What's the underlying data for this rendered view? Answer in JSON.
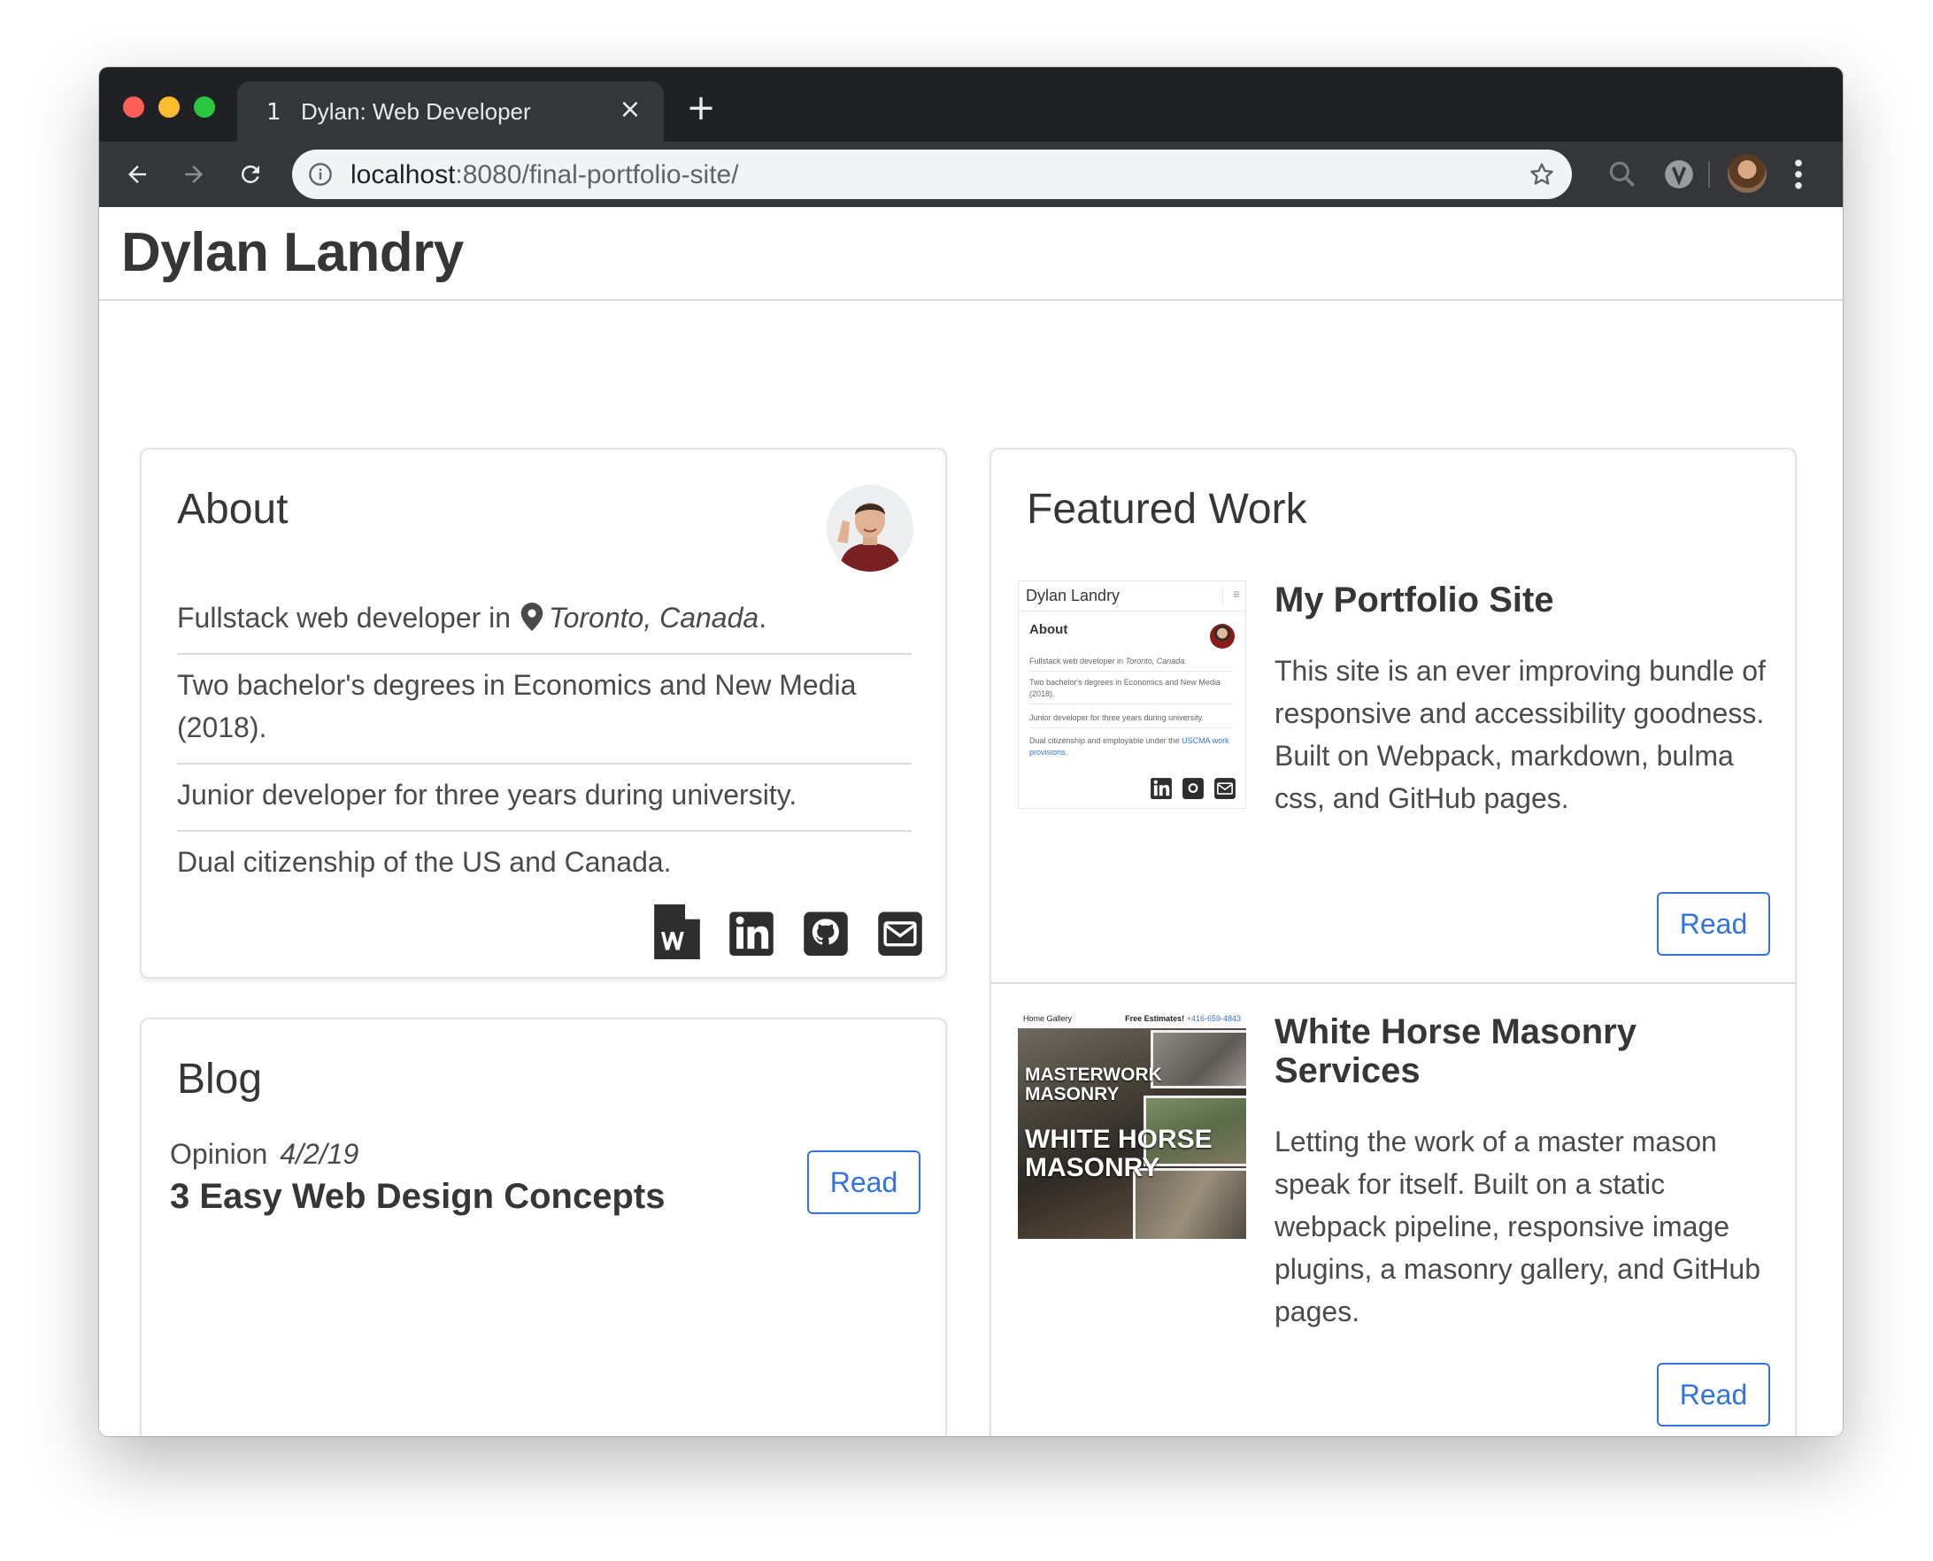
{
  "browser": {
    "tab": {
      "index": "1",
      "title": "Dylan: Web Developer",
      "close": "×"
    },
    "new_tab": "+",
    "url_host": "localhost",
    "url_rest": ":8080/final-portfolio-site/"
  },
  "site": {
    "title": "Dylan Landry"
  },
  "about": {
    "heading": "About",
    "items": {
      "0": {
        "prefix": "Fullstack web developer in",
        "location": "Toronto, Canada",
        "suffix": "."
      },
      "1": {
        "text": "Two bachelor's degrees in Economics and New Media (2018)."
      },
      "2": {
        "text": "Junior developer for three years during university."
      },
      "3": {
        "text": "Dual citizenship of the US and Canada."
      }
    },
    "social": [
      "resume-word-icon",
      "linkedin-icon",
      "github-icon",
      "email-icon"
    ]
  },
  "blog": {
    "heading": "Blog",
    "post": {
      "category": "Opinion",
      "date": "4/2/19",
      "title": "3 Easy Web Design Concepts",
      "read_label": "Read"
    }
  },
  "featured": {
    "heading": "Featured Work",
    "projects": {
      "0": {
        "title": "My Portfolio Site",
        "description": "This site is an ever improving bundle of responsive and accessibility goodness. Built on Webpack, markdown, bulma css, and GitHub pages.",
        "read_label": "Read",
        "thumb": {
          "header": "Dylan Landry",
          "menu": "≡",
          "about": "About",
          "line0_prefix": "Fullstack web developer in",
          "line0_loc": "Toronto, Canada.",
          "line1": "Two bachelor's degrees in Economics and New Media (2018).",
          "line2": "Junior developer for three years during university.",
          "line3_prefix": "Dual citizenship and employable under the",
          "line3_link": "USCMA work provisions",
          "line3_suffix": "."
        }
      },
      "1": {
        "title": "White Horse Masonry Services",
        "description": "Letting the work of a master mason speak for itself. Built on a static webpack pipeline, responsive image plugins, a masonry gallery, and GitHub pages.",
        "read_label": "Read",
        "thumb": {
          "nav": "Home  Gallery",
          "estimate": "Free Estimates!",
          "phone": "+416-659-4843",
          "line1": "MASTERWORK",
          "line2": "MASONRY",
          "line3": "WHITE HORSE",
          "line4": "MASONRY"
        }
      }
    }
  },
  "colors": {
    "link": "#3273dc",
    "text": "#363636",
    "border": "#dbdbdb",
    "chrome_dark": "#202124",
    "chrome_toolbar": "#35363a"
  }
}
